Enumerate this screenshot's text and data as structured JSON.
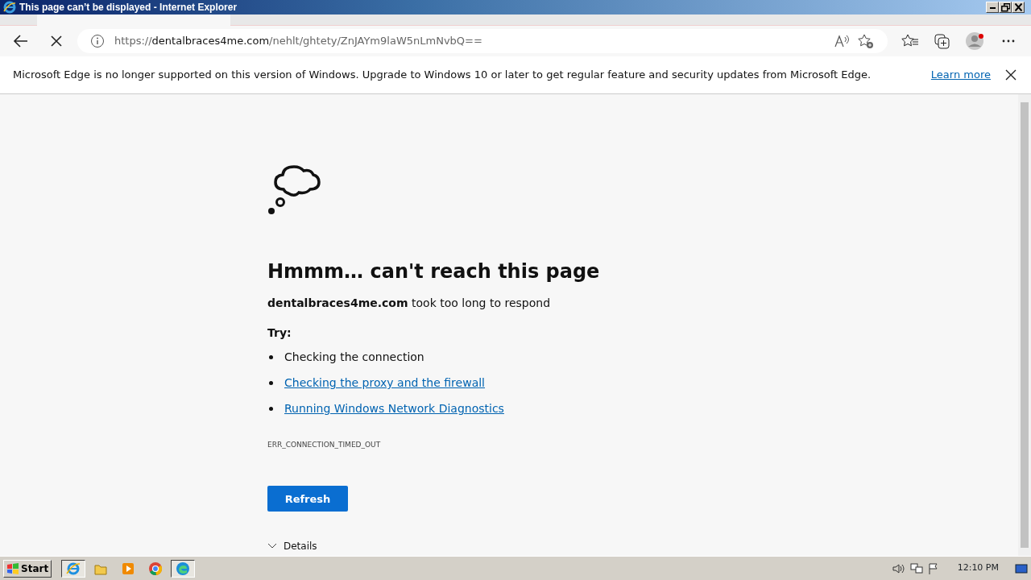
{
  "window": {
    "title": "This page can’t be displayed - Internet Explorer"
  },
  "address_bar": {
    "scheme": "https://",
    "host": "dentalbraces4me.com",
    "path": "/nehlt/ghtety/ZnJAYm9laW5nLmNvbQ=="
  },
  "infobar": {
    "message": "Microsoft Edge is no longer supported on this version of Windows. Upgrade to Windows 10 or later to get regular feature and security updates from Microsoft Edge.",
    "link": "Learn more"
  },
  "error_page": {
    "heading": "Hmmm… can't reach this page",
    "host": "dentalbraces4me.com",
    "message": "took too long to respond",
    "try_label": "Try:",
    "suggestions": [
      {
        "text": "Checking the connection",
        "kind": "text"
      },
      {
        "text": "Checking the proxy and the firewall",
        "kind": "link"
      },
      {
        "text": "Running Windows Network Diagnostics",
        "kind": "link"
      }
    ],
    "error_code": "ERR_CONNECTION_TIMED_OUT",
    "button": "Refresh",
    "details": "Details"
  },
  "taskbar": {
    "start": "Start",
    "apps": [
      {
        "kind": "ie",
        "selected": true
      },
      {
        "kind": "folder",
        "selected": false
      },
      {
        "kind": "media",
        "selected": false
      },
      {
        "kind": "chrome",
        "selected": false
      },
      {
        "kind": "edge",
        "selected": true
      }
    ],
    "clock": "12:10 PM"
  }
}
